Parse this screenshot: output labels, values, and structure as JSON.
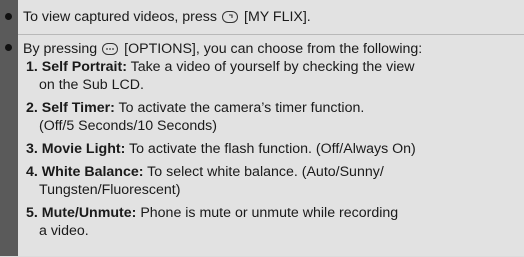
{
  "section1": {
    "prefix": "To view captured videos, press",
    "key_label": "[MY FLIX]."
  },
  "section2": {
    "prefix": "By pressing",
    "key_label": "[OPTIONS], you can choose from the following:",
    "items": [
      {
        "title": "1. Self Portrait:",
        "text": "Take a video of yourself by checking the view",
        "cont": "on the Sub LCD."
      },
      {
        "title": "2. Self Timer:",
        "text": "To activate the camera’s timer function.",
        "cont": "(Off/5 Seconds/10 Seconds)"
      },
      {
        "title": "3. Movie Light:",
        "text": "To activate the flash function. (Off/Always On)",
        "cont": ""
      },
      {
        "title": "4. White Balance:",
        "text": "To select white balance. (Auto/Sunny/",
        "cont": "Tungsten/Fluorescent)"
      },
      {
        "title": "5. Mute/Unmute:",
        "text": "Phone is mute or unmute while recording",
        "cont": "a video."
      }
    ]
  }
}
